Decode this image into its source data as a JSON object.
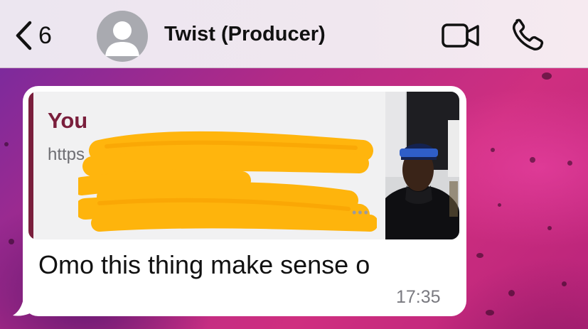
{
  "header": {
    "back_count": "6",
    "contact_name": "Twist (Producer)",
    "icons": {
      "back": "chevron-left-icon",
      "avatar": "person-placeholder-icon",
      "video": "video-camera-icon",
      "call": "phone-icon"
    }
  },
  "message": {
    "quoted": {
      "sender": "You",
      "link_lines": [
        "https",
        "",
        ""
      ],
      "redacted": true
    },
    "text": "Omo this thing make sense o",
    "time": "17:35"
  },
  "colors": {
    "header_bg": "#ece6f0",
    "bubble_bg": "#ffffff",
    "quote_bg": "#f1f1f2",
    "quote_accent": "#7a1f3c",
    "redaction": "#ffb100",
    "wallpaper": "#c42a78"
  }
}
